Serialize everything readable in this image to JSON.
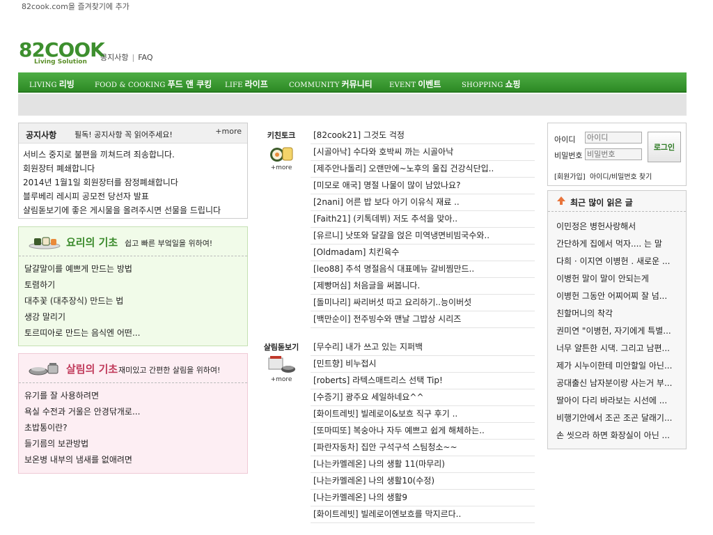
{
  "top_link": "82cook.com을 즐겨찾기에 추가",
  "logo": {
    "main_number": "82",
    "main_text": "COOK",
    "sub": "Living Solution"
  },
  "toplinks": {
    "notice": "공지사항",
    "sep": "|",
    "faq": "FAQ"
  },
  "nav": [
    {
      "en": "LIVING",
      "ko": "리빙"
    },
    {
      "en": "FOOD & COOKING",
      "ko": "푸드 앤 쿠킹"
    },
    {
      "en": "LIFE",
      "ko": "라이프"
    },
    {
      "en": "COMMUNITY",
      "ko": "커뮤니티"
    },
    {
      "en": "EVENT",
      "ko": "이벤트"
    },
    {
      "en": "SHOPPING",
      "ko": "쇼핑"
    }
  ],
  "notice": {
    "title": "공지사항",
    "subtitle": "필독! 공지사항 꼭 읽어주세요!",
    "more": "+more",
    "items": [
      "서비스 중지로 불편을 끼쳐드려 죄송합니다.",
      "회원장터 폐쇄합니다",
      "2014년 1월1일 회원장터를 잠정폐쇄합니다",
      "블루베리 레시피 공모전 당선자 발표",
      "살림돋보기에 좋은 게시물을 올려주시면 선물을 드립니다"
    ]
  },
  "cooking_basics": {
    "title": "요리의 기초",
    "subtitle": "쉽고 빠른 부엌일을 위하여!",
    "items": [
      "달걀말이를 예쁘게 만드는 방법",
      "토렴하기",
      "대추꽃 (대추장식) 만드는 법",
      "생강 말리기",
      "토르띠아로 만드는 음식엔 어떤..."
    ]
  },
  "housekeeping_basics": {
    "title": "살림의 기초",
    "subtitle": "재미있고 간편한 살림을 위하여!",
    "items": [
      "유기를 잘 사용하려면",
      "욕실 수전과 거울은 안경닦개로...",
      "초밥통이란?",
      "들기름의 보관방법",
      "보온병 내부의 냄새를 없애려면"
    ]
  },
  "kitchen_talk": {
    "title": "키친토크",
    "more": "+more",
    "posts": [
      "[82cook21] 그것도 걱정",
      "[시골아낙] 수다와 호박씨 까는 시골아낙",
      "[제주안나돌리] 오랜만에~노후의 울집 건강식단입..",
      "[미모로 애국] 명절 나물이 많이 남았나요?",
      "[2nani] 어른 밥 보다 아기 이유식 재료 ..",
      "[Faith21] (키톡데뷔) 저도 추석을 맞아..",
      "[유르니] 낫또와 달걀을 얹은 미역냉면비빔국수와..",
      "[Oldmadam] 치킨육수",
      "[leo88] 추석 명절음식 대표메뉴 갈비찜만드..",
      "[제빵머심] 처음글을 써봅니다.",
      "[돌미나리] 싸리버섯 따고 요리하기..능이버섯",
      "[백만순이] 전주빙수와 맨날 그밥상 시리즈"
    ]
  },
  "living_spot": {
    "title": "살림돋보기",
    "more": "+more",
    "posts": [
      "[무수리] 내가 쓰고 있는 지퍼백",
      "[민트향] 비누접시",
      "[roberts] 라텍스매트리스 선택 Tip!",
      "[수증기] 광주요 세일하네요^^",
      "[화이트레빗] 빌레로이&보흐 직구 후기 ..",
      "[또마띠또] 복숭아나 자두 예쁘고 쉽게 해체하는..",
      "[파란자동차] 집안 구석구석 스팀청소~~",
      "[나는카멜레온] 나의 생활 11(마무리)",
      "[나는카멜레온] 나의 생활10(수정)",
      "[나는카멜레온] 나의 생활9",
      "[화이트레빗] 빌레로이엔보흐를 막지르다.."
    ]
  },
  "login": {
    "id_label": "아이디",
    "pw_label": "비밀번호",
    "id_placeholder": "아이디",
    "pw_placeholder": "비밀번호",
    "button": "로그인",
    "signup": "[회원가입]",
    "find": "아이디/비밀번호 찾기"
  },
  "popular": {
    "title": "최근 많이 읽은 글",
    "items": [
      "이민정은 병헌사랑해서",
      "간단하게 집에서 먹자.... 는 말",
      "다희 · 이지연 이병헌 . 새로운 ...",
      "이병헌 말이 말이 안되는게",
      "이병헌 그동안 어찌어찌 잘 넘...",
      "친할머니의 착각",
      "권미연 \"이병헌, 자기에게 특별...",
      "너무 얄튼한 시댁. 그리고 남편...",
      "제가 시누이한테 미안할일 아닌...",
      "공대출신 남자분이랑 사는거 부...",
      "딸아이 다리 바라보는 시선에 ...",
      "비행기안에서 조곤 조곤 달래기...",
      "손 씻으라 하면 화장실이 아닌 ..."
    ]
  },
  "colors": {
    "nav_green": "#3a9a31",
    "cook_green": "#3a8a2b",
    "house_pink": "#c0395a"
  }
}
